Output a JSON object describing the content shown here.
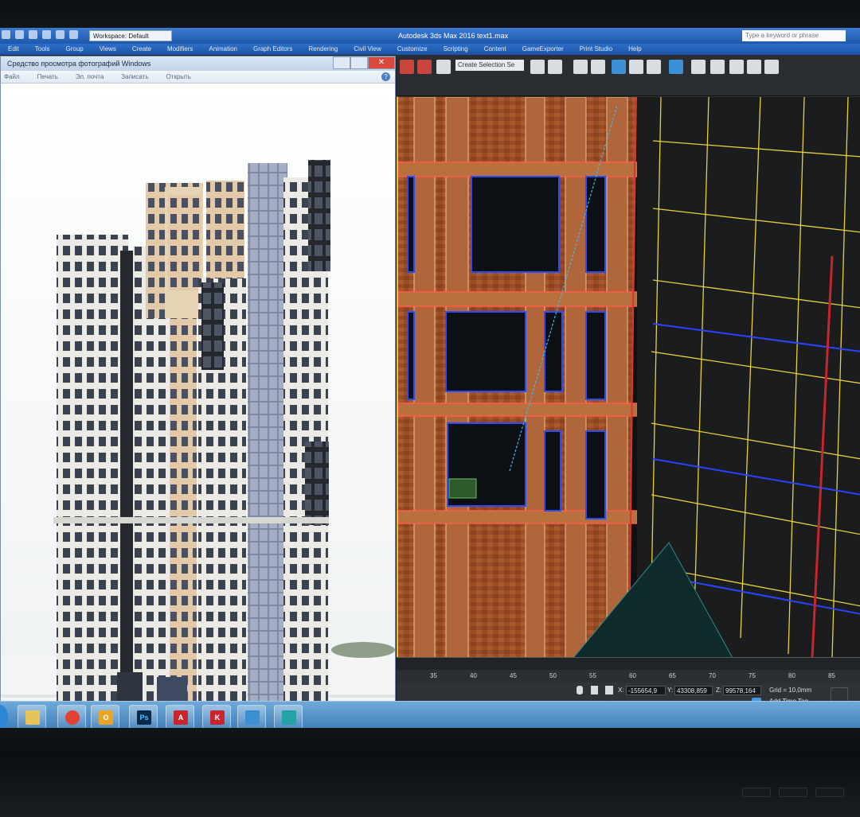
{
  "max": {
    "workspace_label": "Workspace: Default",
    "app_title": "Autodesk 3ds Max 2016   text1.max",
    "search_placeholder": "Type a keyword or phrase",
    "menu": [
      "Edit",
      "Tools",
      "Group",
      "Views",
      "Create",
      "Modifiers",
      "Animation",
      "Graph Editors",
      "Rendering",
      "Civil View",
      "Customize",
      "Scripting",
      "Content",
      "GameExporter",
      "Print Studio",
      "Help"
    ],
    "selection_set": "Create Selection Se",
    "ruler_ticks": [
      "35",
      "40",
      "45",
      "50",
      "55",
      "60",
      "65",
      "70",
      "75",
      "80",
      "85"
    ],
    "coords": {
      "x_label": "X:",
      "x": "-155654,9",
      "y_label": "Y:",
      "y": "43308,859",
      "z_label": "Z:",
      "z": "99578,164"
    },
    "grid": "Grid = 10,0mm",
    "add_time_tag": "Add Time Tag"
  },
  "viewer": {
    "title": "Средство просмотра фотографий Windows",
    "menu": [
      "Файл",
      "Печать",
      "Эл. почта",
      "Записать",
      "Открыть"
    ],
    "help": "?"
  },
  "taskbar": {
    "apps": [
      {
        "name": "explorer-app",
        "glyph": "",
        "color": "#e8c35a"
      },
      {
        "name": "chrome-app",
        "glyph": "",
        "color": "#e34133"
      },
      {
        "name": "outlook-app",
        "glyph": "O",
        "color": "#e8a423"
      },
      {
        "name": "photoshop-app",
        "glyph": "Ps",
        "color": "#0a2a4a"
      },
      {
        "name": "autocad-app",
        "glyph": "A",
        "color": "#c8252d"
      },
      {
        "name": "app-red-k",
        "glyph": "K",
        "color": "#c8252d"
      },
      {
        "name": "photo-viewer-app",
        "glyph": "",
        "color": "#3c8fd0"
      },
      {
        "name": "3dsmax-app",
        "glyph": "",
        "color": "#23a3a3"
      }
    ]
  }
}
